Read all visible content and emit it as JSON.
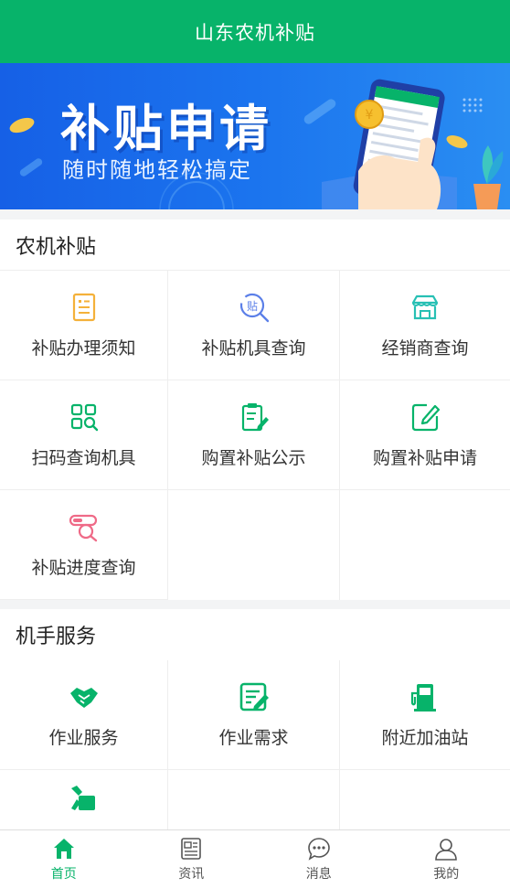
{
  "header": {
    "title": "山东农机补贴"
  },
  "banner": {
    "title": "补贴申请",
    "subtitle": "随时随地轻松搞定"
  },
  "subsidy": {
    "title": "农机补贴",
    "items": [
      {
        "label": "补贴办理须知",
        "icon": "notice-document-icon"
      },
      {
        "label": "补贴机具查询",
        "icon": "subsidy-search-icon"
      },
      {
        "label": "经销商查询",
        "icon": "store-icon"
      },
      {
        "label": "扫码查询机具",
        "icon": "scan-grid-icon"
      },
      {
        "label": "购置补贴公示",
        "icon": "clipboard-edit-icon"
      },
      {
        "label": "购置补贴申请",
        "icon": "edit-form-icon"
      },
      {
        "label": "补贴进度查询",
        "icon": "progress-search-icon"
      }
    ]
  },
  "operator": {
    "title": "机手服务",
    "items": [
      {
        "label": "作业服务",
        "icon": "handshake-icon"
      },
      {
        "label": "作业需求",
        "icon": "demand-edit-icon"
      },
      {
        "label": "附近加油站",
        "icon": "fuel-pump-icon"
      },
      {
        "label": "",
        "icon": "repair-wrench-icon"
      }
    ]
  },
  "tabbar": {
    "items": [
      {
        "label": "首页",
        "icon": "home-icon",
        "active": true
      },
      {
        "label": "资讯",
        "icon": "news-icon",
        "active": false
      },
      {
        "label": "消息",
        "icon": "message-icon",
        "active": false
      },
      {
        "label": "我的",
        "icon": "profile-icon",
        "active": false
      }
    ]
  },
  "colors": {
    "brand": "#07b36a",
    "banner": "#1b6fec",
    "accent_orange": "#f4b13a",
    "accent_blue": "#5b7fe8",
    "accent_pink": "#ef6a87",
    "accent_teal": "#27c0b4"
  }
}
